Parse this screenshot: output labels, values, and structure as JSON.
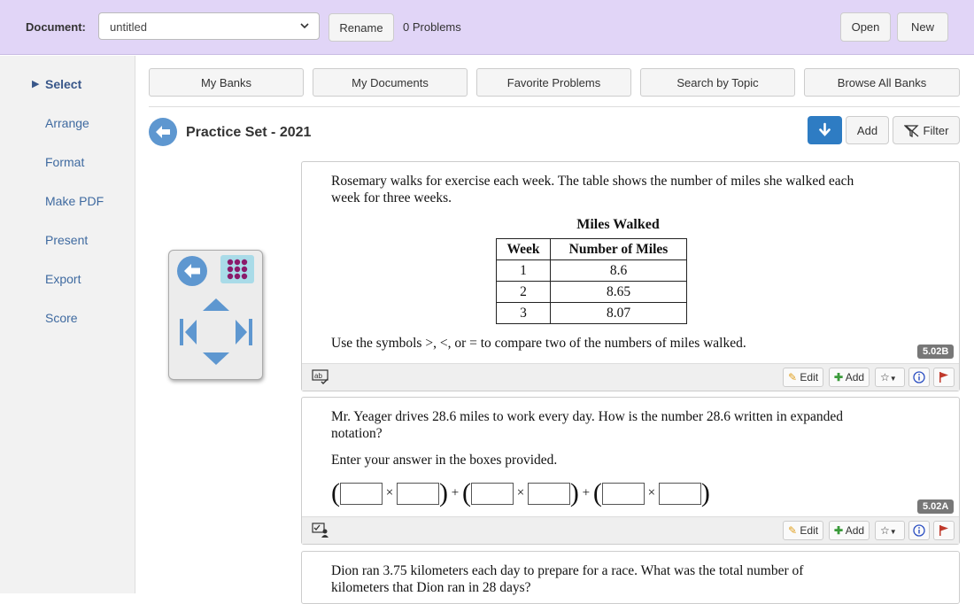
{
  "header": {
    "doc_label": "Document:",
    "doc_value": "untitled",
    "rename": "Rename",
    "problems": "0 Problems",
    "open": "Open",
    "new": "New"
  },
  "sidebar": {
    "items": [
      {
        "label": "Select"
      },
      {
        "label": "Arrange"
      },
      {
        "label": "Format"
      },
      {
        "label": "Make PDF"
      },
      {
        "label": "Present"
      },
      {
        "label": "Export"
      },
      {
        "label": "Score"
      }
    ]
  },
  "tabs": [
    "My Banks",
    "My Documents",
    "Favorite Problems",
    "Search by Topic",
    "Browse All Banks"
  ],
  "set": {
    "title": "Practice Set - 2021",
    "add": "Add",
    "filter": "Filter"
  },
  "colors": {
    "header_bg": "#e1d5f7",
    "accent": "#2e7cc3",
    "icon_blue": "#5e97d0",
    "grid_purple": "#8b1a6b"
  },
  "problems": [
    {
      "text1": "Rosemary walks for exercise each week.  The table shows the number of miles she walked each week for three weeks.",
      "table_title": "Miles Walked",
      "table_headers": [
        "Week",
        "Number of Miles"
      ],
      "table_rows": [
        [
          "1",
          "8.6"
        ],
        [
          "2",
          "8.65"
        ],
        [
          "3",
          "8.07"
        ]
      ],
      "text2": "Use the symbols >, <, or = to compare two of the numbers of miles walked.",
      "badge": "5.02B",
      "edit": "Edit",
      "add": "Add"
    },
    {
      "text1": "Mr. Yeager drives 28.6 miles to work every day.  How is the number 28.6 written in expanded notation?",
      "text2": "Enter your answer in the boxes provided.",
      "times": "×",
      "plus": "+",
      "badge": "5.02A",
      "edit": "Edit",
      "add": "Add"
    },
    {
      "text1": "Dion ran 3.75 kilometers each day to prepare for a race.  What was the total number of kilometers that Dion ran in 28 days?"
    }
  ]
}
